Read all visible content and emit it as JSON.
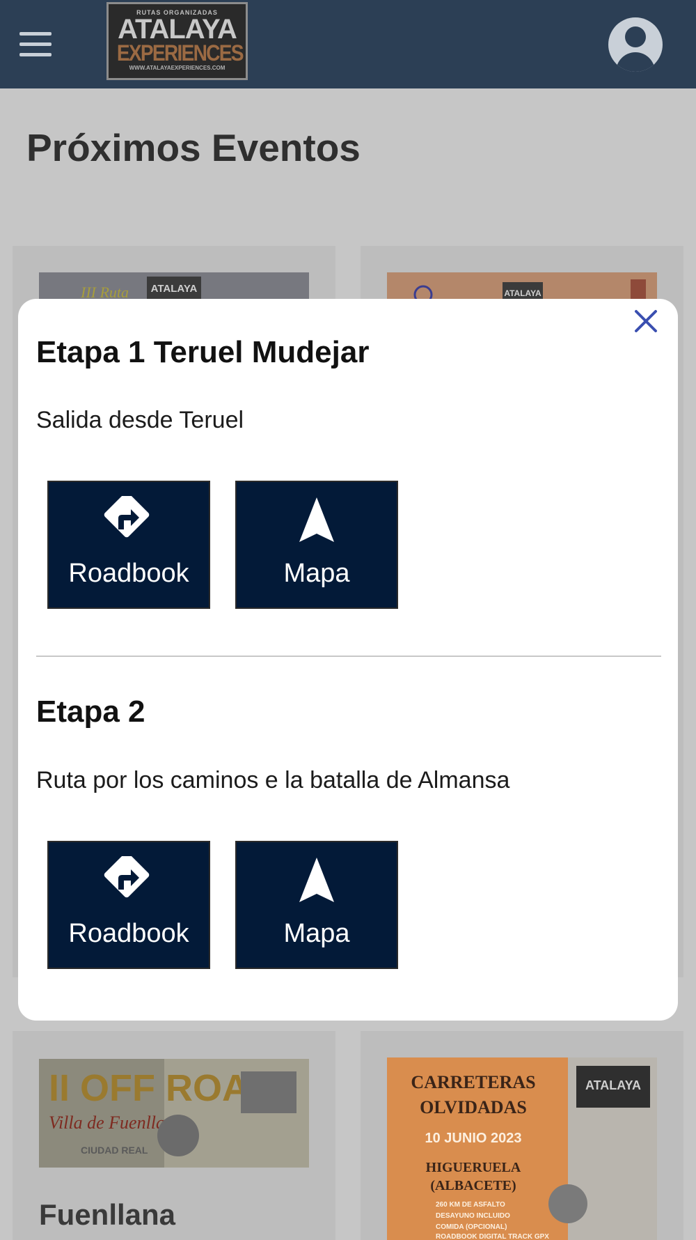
{
  "app": {
    "logo": {
      "top": "RUTAS ORGANIZADAS",
      "line1": "ATALAYA",
      "line2": "EXPERIENCES",
      "url": "WWW.ATALAYAEXPERIENCES.COM"
    }
  },
  "page": {
    "title": "Próximos Eventos"
  },
  "cards": [
    {
      "title": ""
    },
    {
      "title": ""
    },
    {
      "title": "Fuenllana",
      "poster_text": [
        "II OFF ROAD",
        "Villa de Fuenllana",
        "CIUDAD REAL"
      ]
    },
    {
      "title": "",
      "poster_text": [
        "CARRETERAS",
        "OLVIDADAS",
        "10 JUNIO 2023",
        "HIGUERUELA",
        "(ALBACETE)",
        "260 KM DE ASFALTO",
        "DESAYUNO INCLUIDO",
        "COMIDA (OPCIONAL)",
        "ROADBOOK DIGITAL TRACK GPX"
      ]
    }
  ],
  "modal": {
    "stages": [
      {
        "title": "Etapa 1 Teruel Mudejar",
        "description": "Salida desde Teruel",
        "actions": [
          {
            "label": "Roadbook",
            "icon": "turn-right-diamond-icon"
          },
          {
            "label": "Mapa",
            "icon": "navigation-arrow-icon"
          }
        ]
      },
      {
        "title": "Etapa 2",
        "description": "Ruta por los caminos e la batalla de Almansa",
        "actions": [
          {
            "label": "Roadbook",
            "icon": "turn-right-diamond-icon"
          },
          {
            "label": "Mapa",
            "icon": "navigation-arrow-icon"
          }
        ]
      }
    ]
  },
  "colors": {
    "appbar": "#2c3f55",
    "scrim_bg": "#c6c6c6",
    "action_bg": "#031a38",
    "close_icon": "#3a4fb0"
  }
}
